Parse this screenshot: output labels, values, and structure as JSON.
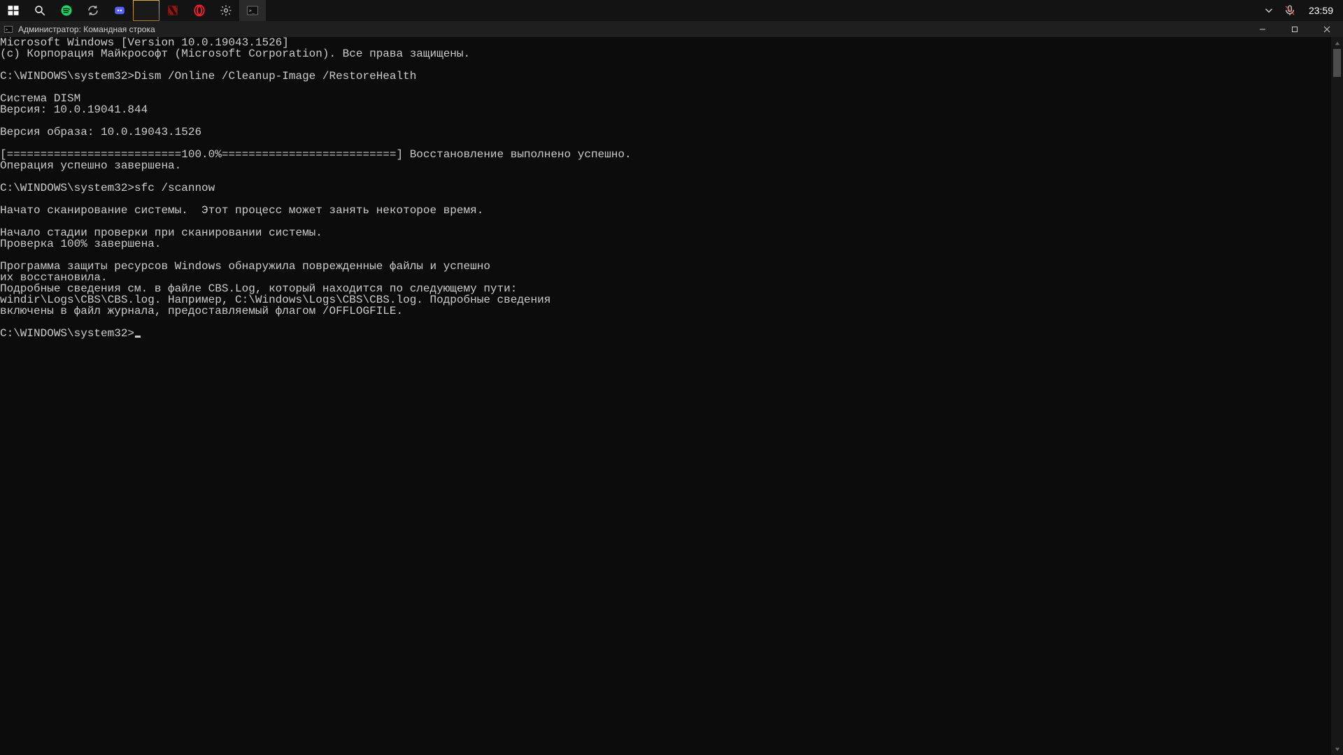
{
  "taskbar": {
    "items": [
      {
        "name": "start-button",
        "icon": "windows-icon"
      },
      {
        "name": "search-button",
        "icon": "search-icon"
      },
      {
        "name": "spotify-button",
        "icon": "spotify-icon"
      },
      {
        "name": "sync-button",
        "icon": "sync-icon"
      },
      {
        "name": "discord-button",
        "icon": "discord-icon"
      },
      {
        "name": "steam-button",
        "icon": "steam-icon",
        "highlighted": true
      },
      {
        "name": "dota-button",
        "icon": "dota-icon"
      },
      {
        "name": "opera-button",
        "icon": "opera-icon"
      },
      {
        "name": "settings-button",
        "icon": "gear-icon"
      },
      {
        "name": "cmd-taskbar-button",
        "icon": "cmd-icon",
        "active": true
      }
    ],
    "tray": {
      "chevron": "▾",
      "mic_muted": true,
      "clock": "23:59"
    }
  },
  "window": {
    "title": "Администратор: Командная строка",
    "controls": {
      "minimize": "—",
      "maximize": "❐",
      "close": "✕"
    }
  },
  "console": {
    "lines": [
      "Microsoft Windows [Version 10.0.19043.1526]",
      "(c) Корпорация Майкрософт (Microsoft Corporation). Все права защищены.",
      "",
      "C:\\WINDOWS\\system32>Dism /Online /Cleanup-Image /RestoreHealth",
      "",
      "Cистема DISM",
      "Версия: 10.0.19041.844",
      "",
      "Версия образа: 10.0.19043.1526",
      "",
      "[==========================100.0%==========================] Восстановление выполнено успешно.",
      "Операция успешно завершена.",
      "",
      "C:\\WINDOWS\\system32>sfc /scannow",
      "",
      "Начато сканирование системы.  Этот процесс может занять некоторое время.",
      "",
      "Начало стадии проверки при сканировании системы.",
      "Проверка 100% завершена.",
      "",
      "Программа защиты ресурсов Windows обнаружила поврежденные файлы и успешно",
      "их восстановила.",
      "Подробные сведения см. в файле CBS.Log, который находится по следующему пути:",
      "windir\\Logs\\CBS\\CBS.log. Например, C:\\Windows\\Logs\\CBS\\CBS.log. Подробные сведения",
      "включены в файл журнала, предоставляемый флагом /OFFLOGFILE.",
      ""
    ],
    "prompt": "C:\\WINDOWS\\system32>"
  }
}
